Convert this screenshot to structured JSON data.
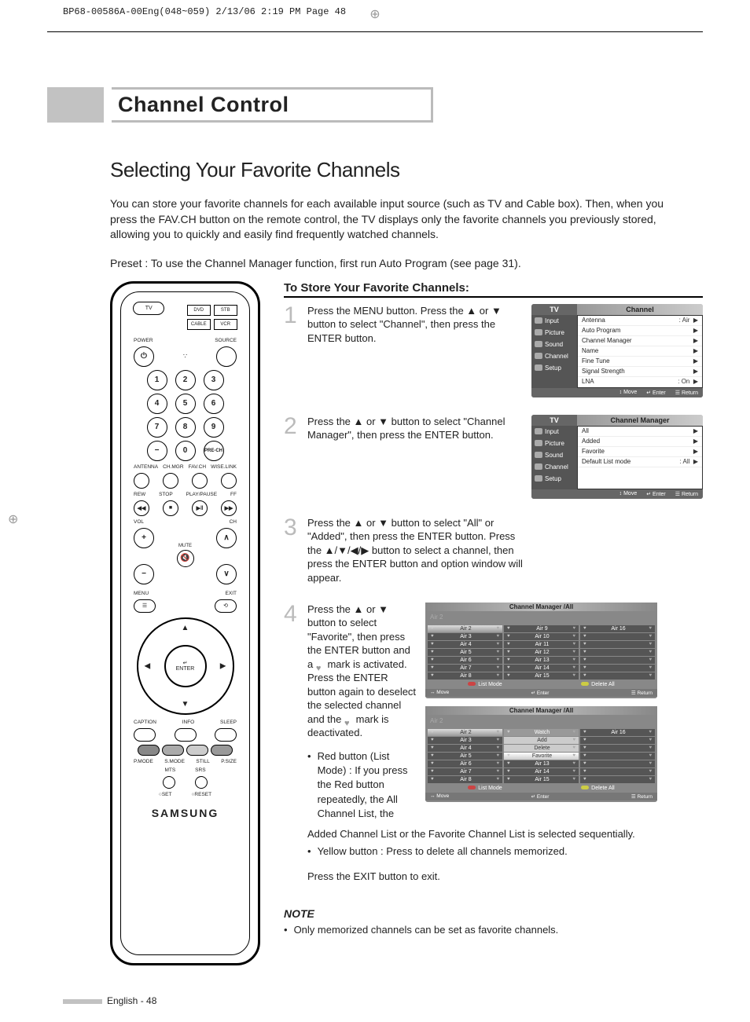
{
  "meta_header": "BP68-00586A-00Eng(048~059)  2/13/06  2:19 PM  Page 48",
  "chapter_title": "Channel Control",
  "section_title": "Selecting Your Favorite Channels",
  "intro_1": "You can store your favorite channels for each available input source (such as TV and Cable box). Then, when you press the FAV.CH button on the remote control, the TV displays only the favorite channels you previously stored, allowing you to quickly and easily find frequently watched channels.",
  "preset": "Preset : To use the Channel Manager function, first run Auto Program (see page 31).",
  "store_head": "To Store Your Favorite Channels:",
  "steps": {
    "s1": "Press the MENU button. Press the ▲ or ▼ button to select \"Channel\", then press the ENTER button.",
    "s2": "Press the ▲ or ▼ button to select \"Channel Manager\", then press the ENTER button.",
    "s3": "Press the ▲ or ▼ button to select \"All\" or \"Added\", then press the ENTER button. Press the ▲/▼/◀/▶ button to select a channel, then press the ENTER button and option window will appear.",
    "s4_a": "Press the ▲ or ▼ button to select \"Favorite\", then press the ENTER button and a ",
    "s4_b": " mark is activated. Press the ENTER button again to deselect the selected channel and the ",
    "s4_c": " mark is deactivated.",
    "red_bullet": "Red button (List Mode) : If you press the Red button repeatedly, the All Channel List, the",
    "after_4": "Added Channel List or the Favorite Channel List is selected sequentially.",
    "yellow_bullet": "Yellow button : Press to delete all channels memorized.",
    "exit": "Press the EXIT button to exit."
  },
  "note_head": "NOTE",
  "note_body": "Only memorized channels can be set as favorite channels.",
  "page_footer": "English - 48",
  "osd1": {
    "tv": "TV",
    "title": "Channel",
    "side": [
      "Input",
      "Picture",
      "Sound",
      "Channel",
      "Setup"
    ],
    "items": [
      {
        "l": "Antenna",
        "r": ": Air",
        "arr": "▶"
      },
      {
        "l": "Auto Program",
        "r": "",
        "arr": "▶"
      },
      {
        "l": "Channel Manager",
        "r": "",
        "arr": "▶"
      },
      {
        "l": "Name",
        "r": "",
        "arr": "▶"
      },
      {
        "l": "Fine Tune",
        "r": "",
        "arr": "▶"
      },
      {
        "l": "Signal Strength",
        "r": "",
        "arr": "▶"
      },
      {
        "l": "LNA",
        "r": ": On",
        "arr": "▶"
      }
    ],
    "foot": [
      "↕ Move",
      "↵ Enter",
      "☰ Return"
    ]
  },
  "osd2": {
    "tv": "TV",
    "title": "Channel Manager",
    "side": [
      "Input",
      "Picture",
      "Sound",
      "Channel",
      "Setup"
    ],
    "items": [
      {
        "l": "All",
        "r": "",
        "arr": "▶"
      },
      {
        "l": "Added",
        "r": "",
        "arr": "▶"
      },
      {
        "l": "Favorite",
        "r": "",
        "arr": "▶"
      },
      {
        "l": "Default List mode",
        "r": ": All",
        "arr": "▶"
      }
    ],
    "foot": [
      "↕ Move",
      "↵ Enter",
      "☰ Return"
    ]
  },
  "grid1": {
    "title": "Channel Manager /All",
    "current": "Air 2",
    "cols": [
      [
        "Air 2",
        "Air 3",
        "Air 4",
        "Air 5",
        "Air 6",
        "Air 7",
        "Air 8"
      ],
      [
        "Air 9",
        "Air 10",
        "Air 11",
        "Air 12",
        "Air 13",
        "Air 14",
        "Air 15"
      ],
      [
        "Air 16",
        "",
        "",
        "",
        "",
        "",
        ""
      ]
    ],
    "listmode": "List Mode",
    "deleteall": "Delete All",
    "hint": [
      "↔ Move",
      "↵ Enter",
      "☰ Return"
    ]
  },
  "grid2": {
    "title": "Channel Manager /All",
    "current": "Air 2",
    "col1": [
      "Air 2",
      "Air 3",
      "Air 4",
      "Air 5",
      "Air 6",
      "Air 7",
      "Air 8"
    ],
    "popup": [
      "Watch",
      "Add",
      "Delete",
      "Favorite"
    ],
    "col2_after": [
      "Air 13",
      "Air 14",
      "Air 15"
    ],
    "col3_first": "Air 16",
    "listmode": "List Mode",
    "deleteall": "Delete All",
    "hint": [
      "↔ Move",
      "↵ Enter",
      "☰ Return"
    ]
  },
  "remote": {
    "tv": "TV",
    "dvd": "DVD",
    "stb": "STB",
    "cable": "CABLE",
    "vcr": "VCR",
    "power": "POWER",
    "source": "SOURCE",
    "antenna": "ANTENNA",
    "chmgr": "CH.MGR",
    "favch": "FAV.CH",
    "wiselink": "WISE.LINK",
    "rew": "REW",
    "stop": "STOP",
    "play": "PLAY/PAUSE",
    "ff": "FF",
    "vol": "VOL",
    "mute": "MUTE",
    "prech": "PRE-CH",
    "ch": "CH",
    "menu": "MENU",
    "exit": "EXIT",
    "enter": "ENTER",
    "caption": "CAPTION",
    "info": "INFO",
    "sleep": "SLEEP",
    "pmode": "P.MODE",
    "smode": "S.MODE",
    "still": "STILL",
    "psize": "P.SIZE",
    "mts": "MTS",
    "srs": "SRS",
    "set": "SET",
    "reset": "RESET",
    "brand": "SAMSUNG"
  }
}
